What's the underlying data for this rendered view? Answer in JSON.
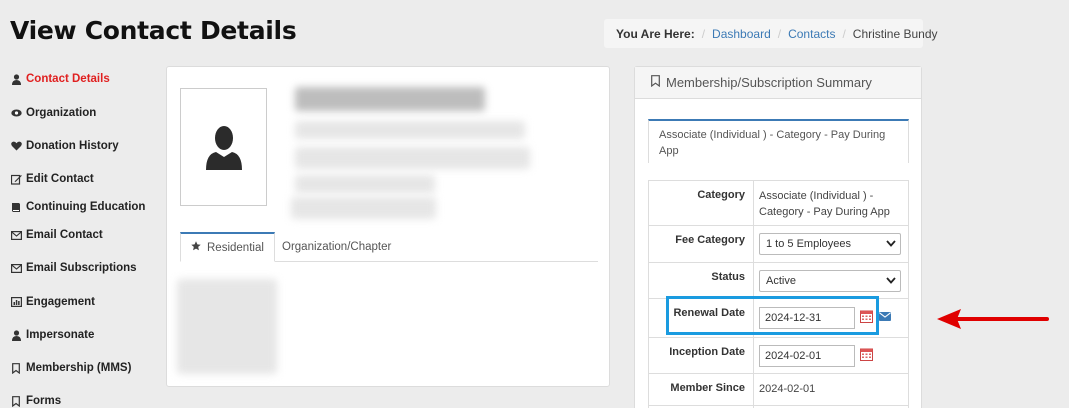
{
  "page": {
    "title": "View Contact Details"
  },
  "breadcrumb": {
    "label": "You Are Here:",
    "items": [
      "Dashboard",
      "Contacts"
    ],
    "current": "Christine Bundy"
  },
  "sidebar": {
    "items": [
      {
        "label": "Contact Details",
        "icon": "user-icon",
        "active": true
      },
      {
        "label": "Organization",
        "icon": "eye-icon"
      },
      {
        "label": "Donation History",
        "icon": "heart-icon"
      },
      {
        "label": "Edit Contact",
        "icon": "edit-icon"
      },
      {
        "label": "Continuing Education",
        "icon": "book-icon"
      },
      {
        "label": "Email Contact",
        "icon": "envelope-icon"
      },
      {
        "label": "Email Subscriptions",
        "icon": "envelope-icon"
      },
      {
        "label": "Engagement",
        "icon": "chart-icon"
      },
      {
        "label": "Impersonate",
        "icon": "user-icon"
      },
      {
        "label": "Membership (MMS)",
        "icon": "bookmark-icon"
      },
      {
        "label": "Forms",
        "icon": "bookmark-icon"
      }
    ]
  },
  "contact": {
    "tabs": [
      "Residential",
      "Organization/Chapter"
    ]
  },
  "summary": {
    "title": "Membership/Subscription Summary",
    "plan_tab": "Associate (Individual ) - Category - Pay During App",
    "rows": {
      "category": {
        "label": "Category",
        "value": "Associate (Individual ) - Category - Pay During App"
      },
      "fee_category": {
        "label": "Fee Category",
        "value": "1 to 5 Employees"
      },
      "status": {
        "label": "Status",
        "value": "Active"
      },
      "renewal_date": {
        "label": "Renewal Date",
        "value": "2024-12-31"
      },
      "inception_date": {
        "label": "Inception Date",
        "value": "2024-02-01"
      },
      "member_since": {
        "label": "Member Since",
        "value": "2024-02-01"
      }
    }
  },
  "colors": {
    "accent": "#3c7ab5",
    "active": "#e02020",
    "highlight": "#1a9be0",
    "arrow": "#e00000"
  }
}
